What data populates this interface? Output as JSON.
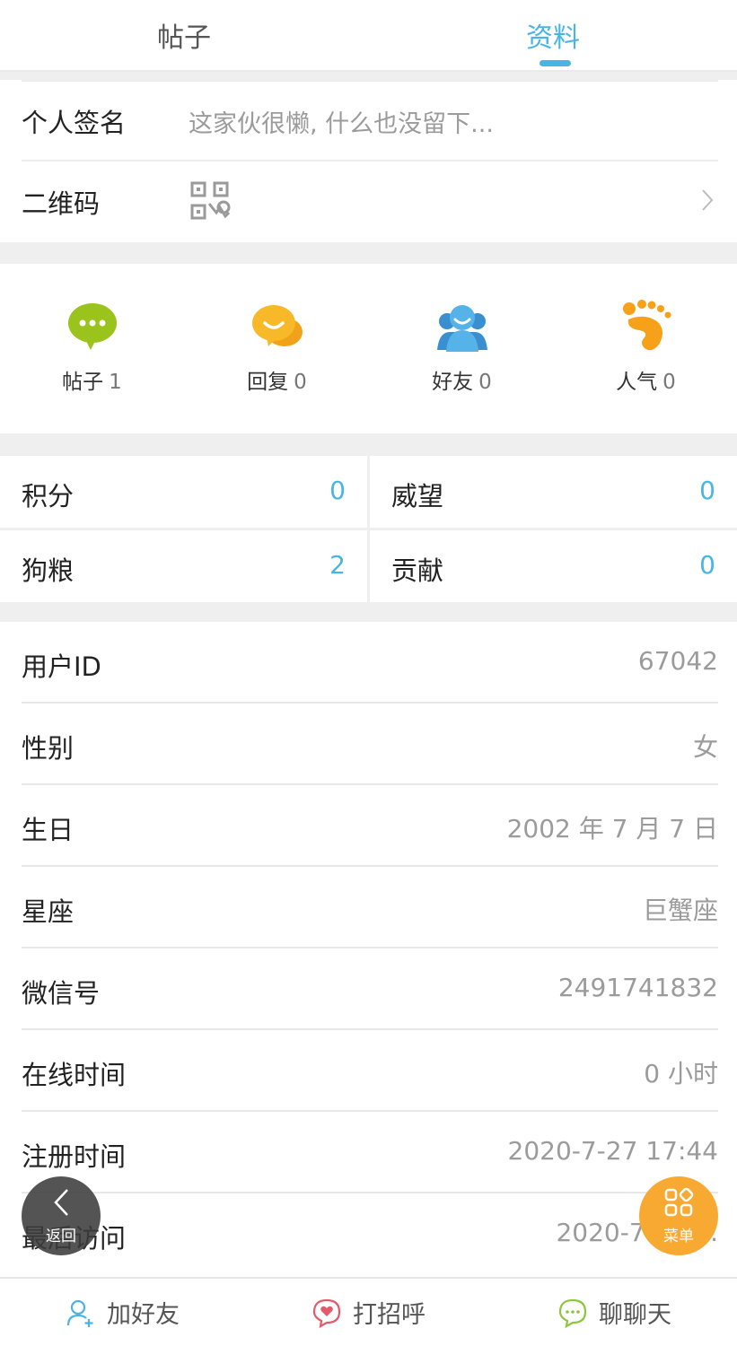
{
  "tabs": [
    {
      "label": "帖子",
      "active": false
    },
    {
      "label": "资料",
      "active": true
    }
  ],
  "accent_color": "#4ab4e4",
  "profile": {
    "signature_label": "个人签名",
    "signature_value": "这家伙很懒, 什么也没留下...",
    "qrcode_label": "二维码",
    "qrcode_icon": "qr-code-icon",
    "chevron_icon": "chevron-right-icon"
  },
  "stats": [
    {
      "label": "帖子",
      "value": "1",
      "icon": "speech-bubble-icon",
      "color": "#9ac31c"
    },
    {
      "label": "回复",
      "value": "0",
      "icon": "reply-bubbles-icon",
      "color": "#f5b21c"
    },
    {
      "label": "好友",
      "value": "0",
      "icon": "friends-icon",
      "color": "#4aa8e0"
    },
    {
      "label": "人气",
      "value": "0",
      "icon": "footprint-icon",
      "color": "#f7a11a"
    }
  ],
  "scores": [
    {
      "label": "积分",
      "value": "0"
    },
    {
      "label": "威望",
      "value": "0"
    },
    {
      "label": "狗粮",
      "value": "2"
    },
    {
      "label": "贡献",
      "value": "0"
    }
  ],
  "info": [
    {
      "label": "用户ID",
      "value": "67042"
    },
    {
      "label": "性别",
      "value": "女"
    },
    {
      "label": "生日",
      "value": "2002 年 7 月 7 日"
    },
    {
      "label": "星座",
      "value": "巨蟹座"
    },
    {
      "label": "微信号",
      "value": "2491741832"
    },
    {
      "label": "在线时间",
      "value": "0 小时"
    },
    {
      "label": "注册时间",
      "value": "2020-7-27 17:44"
    },
    {
      "label": "最后访问",
      "value": "2020-7-28 ..."
    }
  ],
  "floating": {
    "back_label": "返回",
    "menu_label": "菜单"
  },
  "bottom_bar": [
    {
      "label": "加好友",
      "icon": "add-friend-icon"
    },
    {
      "label": "打招呼",
      "icon": "greet-heart-icon"
    },
    {
      "label": "聊聊天",
      "icon": "chat-icon"
    }
  ]
}
